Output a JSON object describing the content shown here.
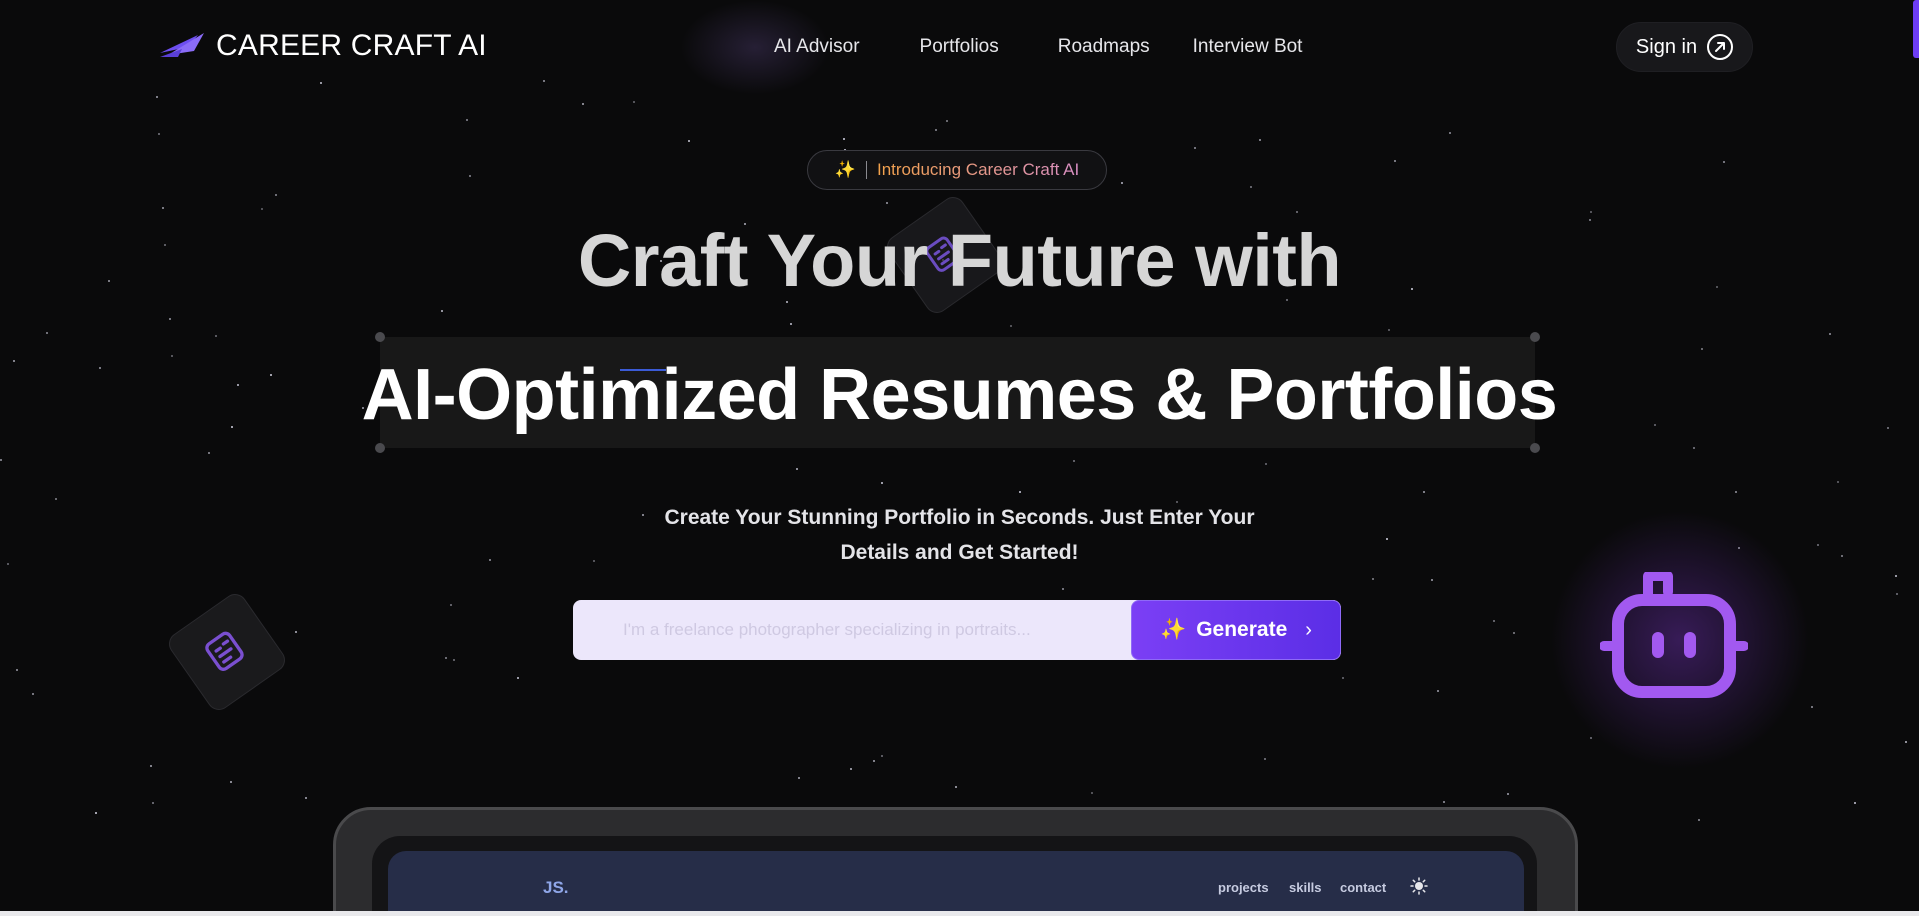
{
  "nav": {
    "logo_text": "CAREER CRAFT AI",
    "links": [
      "AI Advisor",
      "Portfolios",
      "Roadmaps",
      "Interview Bot"
    ],
    "signin_label": "Sign in"
  },
  "badge": {
    "emoji": "✨",
    "text": "Introducing Career Craft AI"
  },
  "hero": {
    "line1": "Craft Your Future with",
    "line2": "AI-Optimized Resumes & Portfolios",
    "subtitle_line1": "Create Your Stunning Portfolio in Seconds. Just Enter Your",
    "subtitle_line2": "Details and Get Started!"
  },
  "generator": {
    "placeholder": "I'm a freelance photographer specializing in portraits...",
    "button_emoji": "✨",
    "button_label": "Generate"
  },
  "preview": {
    "logo": "JS.",
    "nav": [
      "projects",
      "skills",
      "contact"
    ]
  },
  "colors": {
    "background": "#0a0a0b",
    "accent_purple": "#7b3ff5",
    "robot_purple": "#a259f0",
    "badge_gradient_start": "#f3a24a"
  },
  "icons": {
    "logo": "paper-plane-icon",
    "signin": "arrow-up-right-circle-icon",
    "robot": "robot-icon",
    "document": "document-icon",
    "theme": "sun-icon"
  }
}
